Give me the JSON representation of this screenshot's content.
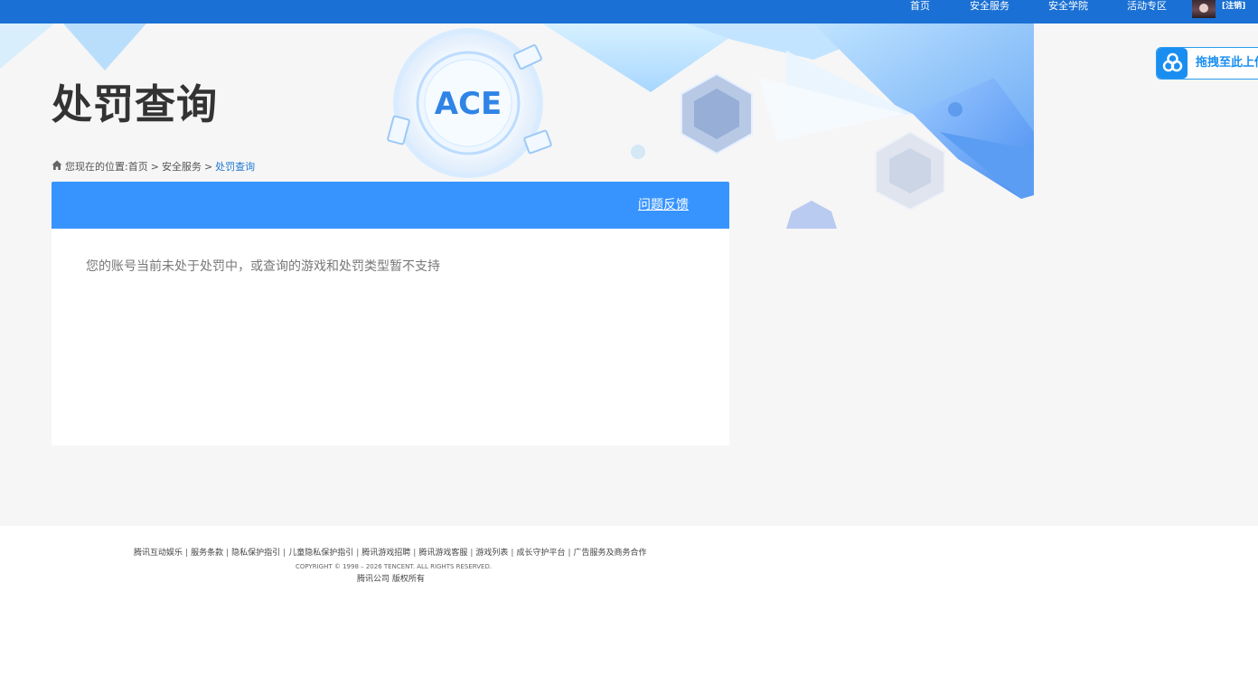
{
  "topnav": {
    "items": [
      "首页",
      "安全服务",
      "安全学院",
      "活动专区"
    ],
    "logout": "[注销]"
  },
  "banner": {
    "logo_text": "ACE"
  },
  "page": {
    "title": "处罚查询"
  },
  "breadcrumb": {
    "prefix": "您现在的位置:",
    "home": "首页",
    "section": "安全服务",
    "current": "处罚查询",
    "separator": ">"
  },
  "panel": {
    "feedback": "问题反馈",
    "message": "您的账号当前未处于处罚中，或查询的游戏和处罚类型暂不支持"
  },
  "upload_widget": {
    "label": "拖拽至此上传"
  },
  "footer": {
    "links": [
      "腾讯互动娱乐",
      "服务条款",
      "隐私保护指引",
      "儿童隐私保护指引",
      "腾讯游戏招聘",
      "腾讯游戏客服",
      "游戏列表",
      "成长守护平台",
      "广告服务及商务合作"
    ],
    "copyright": "COPYRIGHT © 1998 – 2026 TENCENT. ALL RIGHTS RESERVED.",
    "rights": "腾讯公司 版权所有"
  },
  "colors": {
    "topbar": "#1a70d4",
    "panel_header": "#3794ff",
    "breadcrumb_current": "#1f78d1",
    "page_bg": "#f6f6f6"
  }
}
